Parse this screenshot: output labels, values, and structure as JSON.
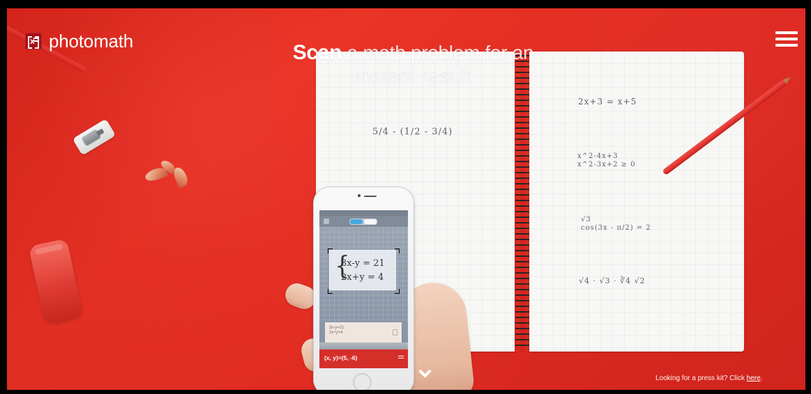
{
  "brand": {
    "name": "photomath"
  },
  "hero": {
    "headline_bold": "Scan",
    "headline_rest": " a math problem for an",
    "headline_line2": "instant result"
  },
  "press_kit": {
    "text": "Looking for a press kit? Click ",
    "link_label": "here",
    "period": "."
  },
  "phone": {
    "scan_line_1": "3x-y = 21",
    "scan_line_2": "2x+y = 4",
    "result_card_text": "3x-y=21\n2x+y=4",
    "answer": "(x, y)=(5, -6)"
  },
  "notebook": {
    "left_eq": "5/4 - (1/2 - 3/4)",
    "right_eq_1": "2x+3 = x+5",
    "right_eq_2": "x^2-4x+3\nx^2-3x+2  ≥ 0",
    "right_eq_3": "√3\ncos(3x - π/2) = 2",
    "right_eq_4": "√4 · √3 · ∛4 √2"
  },
  "icons": {
    "menu": "hamburger-menu-icon",
    "chevron_down": "chevron-down-icon",
    "logo": "photomath-logo-icon"
  },
  "colors": {
    "hero_red": "#df2b22",
    "brand_red": "#a80f17",
    "answer_red": "#d52f2a",
    "scan_blue": "#47a7e0",
    "white": "#ffffff"
  }
}
